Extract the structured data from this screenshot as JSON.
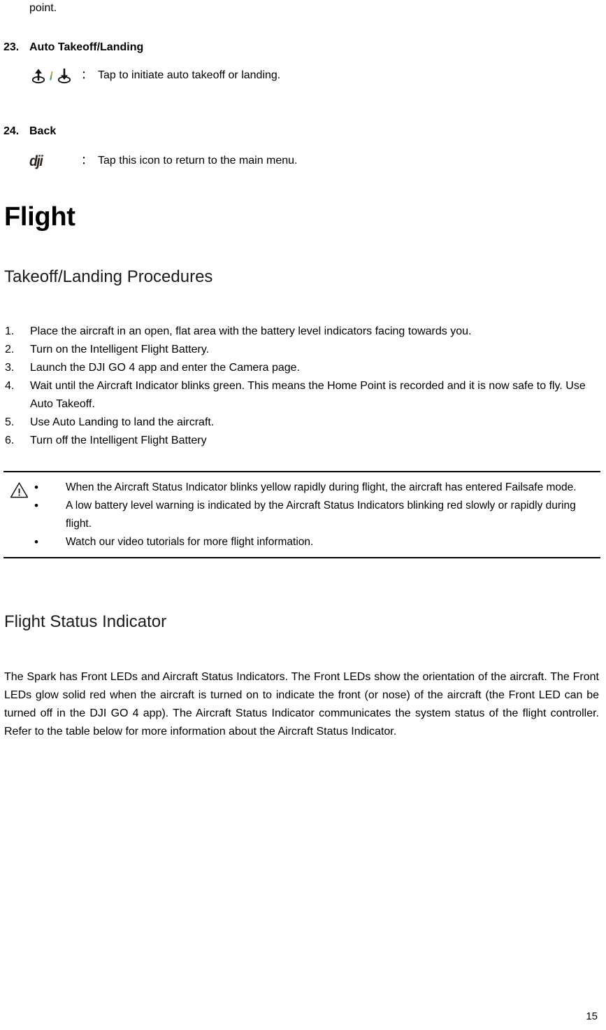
{
  "page": {
    "number": "15",
    "continuation_text": "point."
  },
  "controls": [
    {
      "number": "23.",
      "title": "Auto Takeoff/Landing",
      "icon": "takeoff-landing-icon",
      "colon": "：",
      "description": "Tap to initiate auto takeoff or landing."
    },
    {
      "number": "24.",
      "title": "Back",
      "icon": "dji-logo-icon",
      "icon_text": "dji",
      "colon": "：",
      "description": "Tap this icon to return to the main menu."
    }
  ],
  "chapter": {
    "title": "Flight"
  },
  "sections": [
    {
      "heading": "Takeoff/Landing Procedures",
      "steps": [
        {
          "number": "1.",
          "text": "Place the aircraft in an open, flat area with the battery level indicators facing towards you."
        },
        {
          "number": "2.",
          "text": "Turn on the Intelligent Flight Battery."
        },
        {
          "number": "3.",
          "text": "Launch the DJI GO 4 app and enter the Camera page."
        },
        {
          "number": "4.",
          "text": "Wait until the Aircraft Indicator blinks green. This means the Home Point is recorded and it is now safe to fly. Use Auto Takeoff."
        },
        {
          "number": "5.",
          "text": "Use Auto Landing to land the aircraft."
        },
        {
          "number": "6.",
          "text": "Turn off the Intelligent Flight Battery"
        }
      ]
    },
    {
      "heading": "Flight Status Indicator",
      "paragraph": "The Spark has Front LEDs and Aircraft Status Indicators. The Front LEDs show the orientation of the aircraft. The Front LEDs glow solid red when the aircraft is turned on to indicate the front (or nose) of the aircraft (the Front LED can be turned off in the DJI GO 4 app). The Aircraft Status Indicator communicates the system status of the flight controller. Refer to the table below for more information about the Aircraft Status Indicator."
    }
  ],
  "note_box": {
    "icon": "warning-triangle-icon",
    "bullet_glyph": "•",
    "items": [
      "When the Aircraft Status Indicator blinks yellow rapidly during flight, the aircraft has entered Failsafe mode.",
      "A low battery level warning is indicated by the Aircraft Status Indicators blinking red slowly or rapidly during flight.",
      "Watch our video tutorials for more flight information."
    ]
  }
}
